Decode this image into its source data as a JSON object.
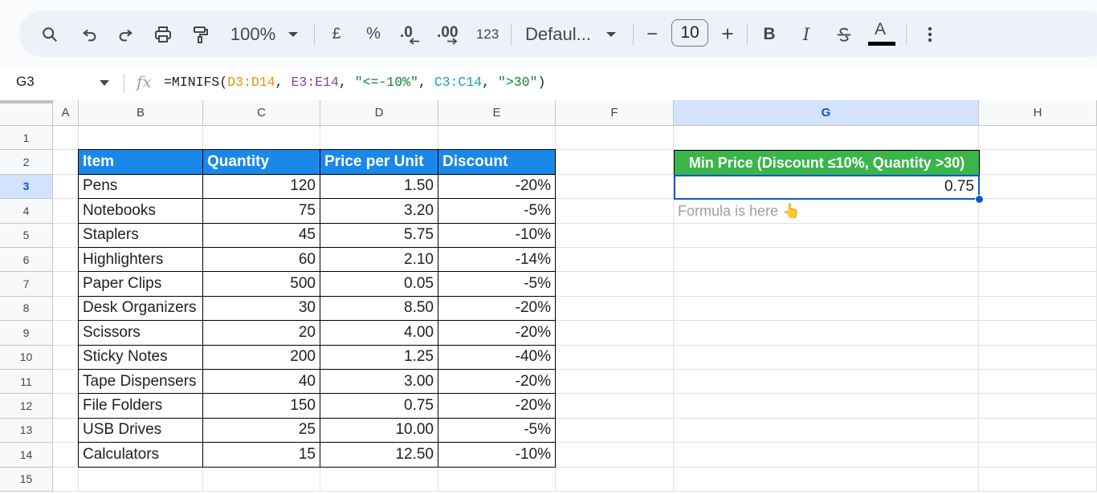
{
  "toolbar": {
    "zoom": "100%",
    "currency": "£",
    "percent": "%",
    "decrease_decimal": ".0",
    "increase_decimal": ".00",
    "number_format": "123",
    "font_name": "Defaul...",
    "font_size": "10",
    "minus": "−",
    "plus": "+",
    "bold": "B",
    "italic": "I",
    "text_color": "A"
  },
  "formula_bar": {
    "cell_ref": "G3",
    "fx": "fx",
    "parts": [
      "=MINIFS(",
      "D3:D14",
      ", ",
      "E3:E14",
      ", ",
      "\"<=-10%\"",
      ", ",
      "C3:C14",
      ", ",
      "\">30\"",
      ")"
    ]
  },
  "columns": [
    "A",
    "B",
    "C",
    "D",
    "E",
    "F",
    "G",
    "H"
  ],
  "rows": [
    "1",
    "2",
    "3",
    "4",
    "5",
    "6",
    "7",
    "8",
    "9",
    "10",
    "11",
    "12",
    "13",
    "14",
    "15"
  ],
  "table": {
    "headers": [
      "Item",
      "Quantity",
      "Price per Unit",
      "Discount"
    ],
    "rows": [
      [
        "Pens",
        "120",
        "1.50",
        "-20%"
      ],
      [
        "Notebooks",
        "75",
        "3.20",
        "-5%"
      ],
      [
        "Staplers",
        "45",
        "5.75",
        "-10%"
      ],
      [
        "Highlighters",
        "60",
        "2.10",
        "-14%"
      ],
      [
        "Paper Clips",
        "500",
        "0.05",
        "-5%"
      ],
      [
        "Desk Organizers",
        "30",
        "8.50",
        "-20%"
      ],
      [
        "Scissors",
        "20",
        "4.00",
        "-20%"
      ],
      [
        "Sticky Notes",
        "200",
        "1.25",
        "-40%"
      ],
      [
        "Tape Dispensers",
        "40",
        "3.00",
        "-20%"
      ],
      [
        "File Folders",
        "150",
        "0.75",
        "-20%"
      ],
      [
        "USB Drives",
        "25",
        "10.00",
        "-5%"
      ],
      [
        "Calculators",
        "15",
        "12.50",
        "-10%"
      ]
    ]
  },
  "result": {
    "header": "Min Price (Discount ≤10%, Quantity >30)",
    "value": "0.75",
    "note": "Formula is here 👆"
  },
  "colors": {
    "table_header": "#1a88e8",
    "result_header": "#3ab54a",
    "selection": "#0b57d0"
  }
}
